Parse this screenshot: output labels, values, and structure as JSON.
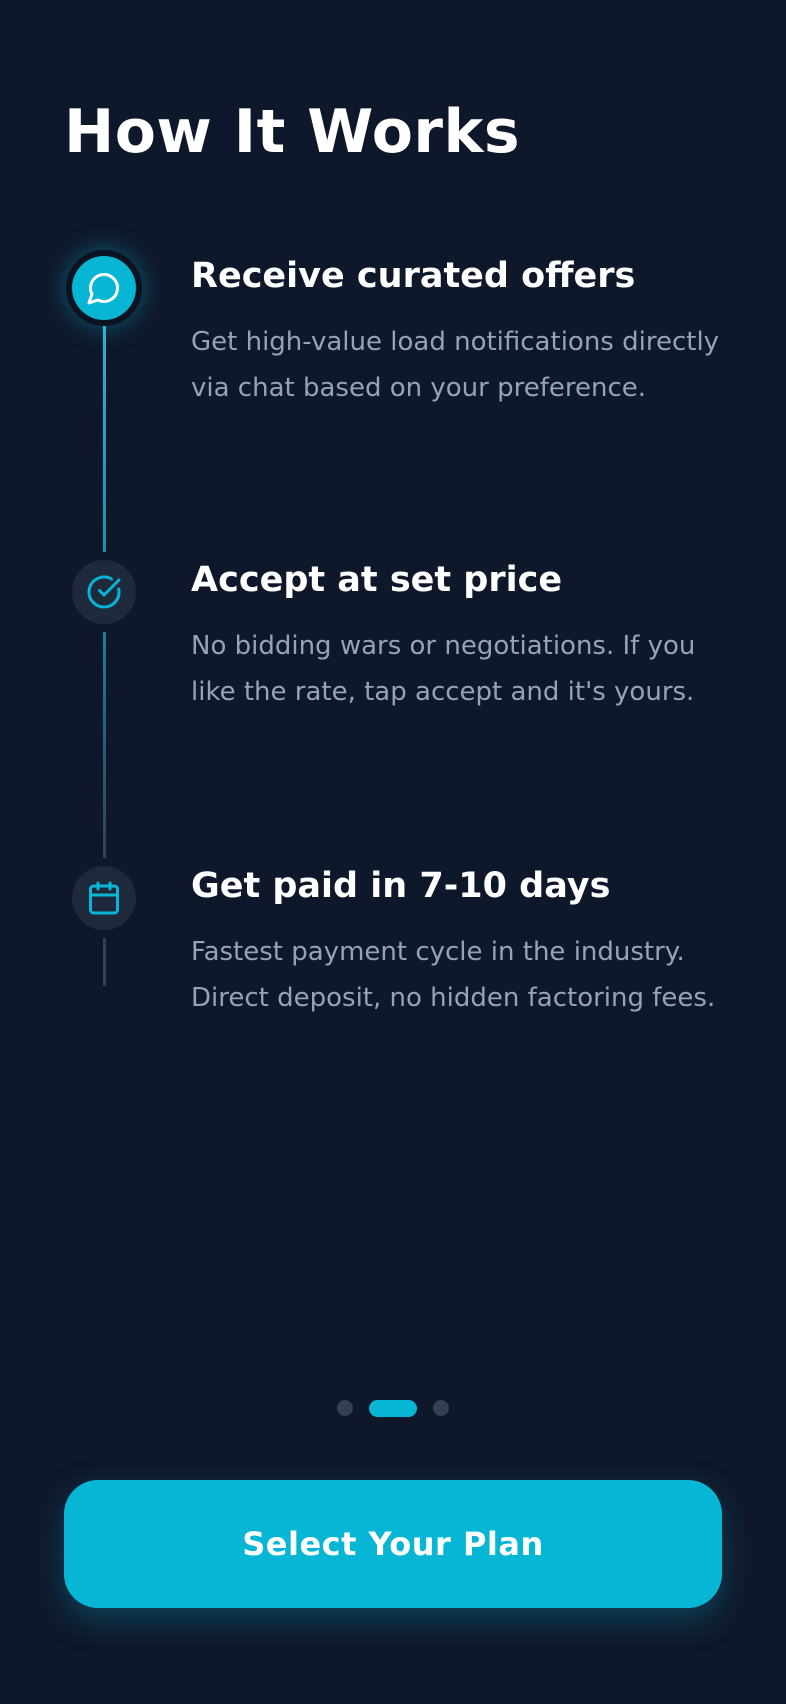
{
  "header": {
    "title": "How It Works"
  },
  "steps": [
    {
      "icon": "chat-bubble-icon",
      "title": "Receive curated offers",
      "description": "Get high-value load notifications directly via chat based on your preference."
    },
    {
      "icon": "check-circle-icon",
      "title": "Accept at set price",
      "description": "No bidding wars or negotiations. If you like the rate, tap accept and it's yours."
    },
    {
      "icon": "calendar-icon",
      "title": "Get paid in 7-10 days",
      "description": "Fastest payment cycle in the industry. Direct deposit, no hidden factoring fees."
    }
  ],
  "pagination": {
    "total": 3,
    "current": 2
  },
  "cta": {
    "label": "Select Your Plan"
  },
  "colors": {
    "background": "#0f172a",
    "accent": "#06b6d4",
    "muted_text": "#94a3b8",
    "inactive_circle": "#1e293b",
    "inactive_dot": "#334155"
  }
}
